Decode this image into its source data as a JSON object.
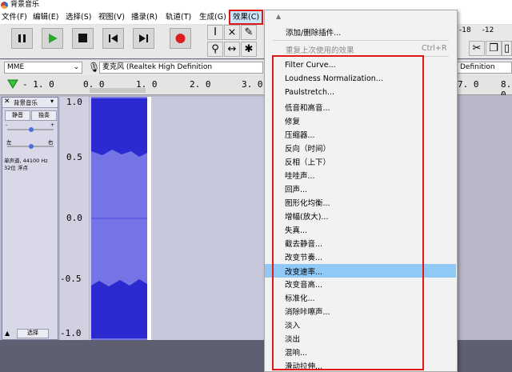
{
  "window": {
    "title": "背景音乐"
  },
  "menubar": {
    "items": [
      "文件(F)",
      "编辑(E)",
      "选择(S)",
      "视图(V)",
      "播录(R)",
      "轨道(T)",
      "生成(G)",
      "效果(C)"
    ]
  },
  "toolbar": {
    "pause": "pause-icon",
    "play": "play-icon",
    "stop": "stop-icon",
    "skip_start": "skip-start-icon",
    "skip_end": "skip-end-icon",
    "record": "record-icon"
  },
  "devices": {
    "host": "MME",
    "mic": "麦克风 (Realtek High Definition",
    "right_partial": "Definition"
  },
  "ruler": {
    "ticks": [
      "- 1. 0",
      "0. 0",
      "1. 0",
      "2. 0",
      "3. 0",
      "7. 0",
      "8. 0"
    ],
    "small": [
      "-18",
      "-12"
    ]
  },
  "track": {
    "name": "背景音乐",
    "mute": "静音",
    "solo": "独奏",
    "left": "左",
    "right": "右",
    "info_line1": "单声道, 44100 Hz",
    "info_line2": "32位 浮点",
    "select": "选择",
    "yticks": [
      "1.0",
      "0.5",
      "0.0",
      "-0.5",
      "-1.0"
    ]
  },
  "effects_menu": {
    "top_items": [
      "添加/删除插件...",
      "重复上次使用的效果"
    ],
    "shortcut": "Ctrl+R",
    "items": [
      "Filter Curve...",
      "Loudness Normalization...",
      "Paulstretch...",
      "低音和高音...",
      "修复",
      "压缩器...",
      "反向（时间）",
      "反相（上下）",
      "哇哇声...",
      "回声...",
      "图形化均衡...",
      "增幅(放大)...",
      "失真...",
      "截去静音...",
      "改变节奏...",
      "改变速率...",
      "改变音高...",
      "标准化...",
      "消除咔嚓声...",
      "淡入",
      "淡出",
      "混响...",
      "滑动拉伸..."
    ],
    "highlighted_index": 15
  },
  "colors": {
    "accent_red": "#e01818",
    "highlight": "#90c8f6",
    "waveform": "#3b3bd6"
  }
}
